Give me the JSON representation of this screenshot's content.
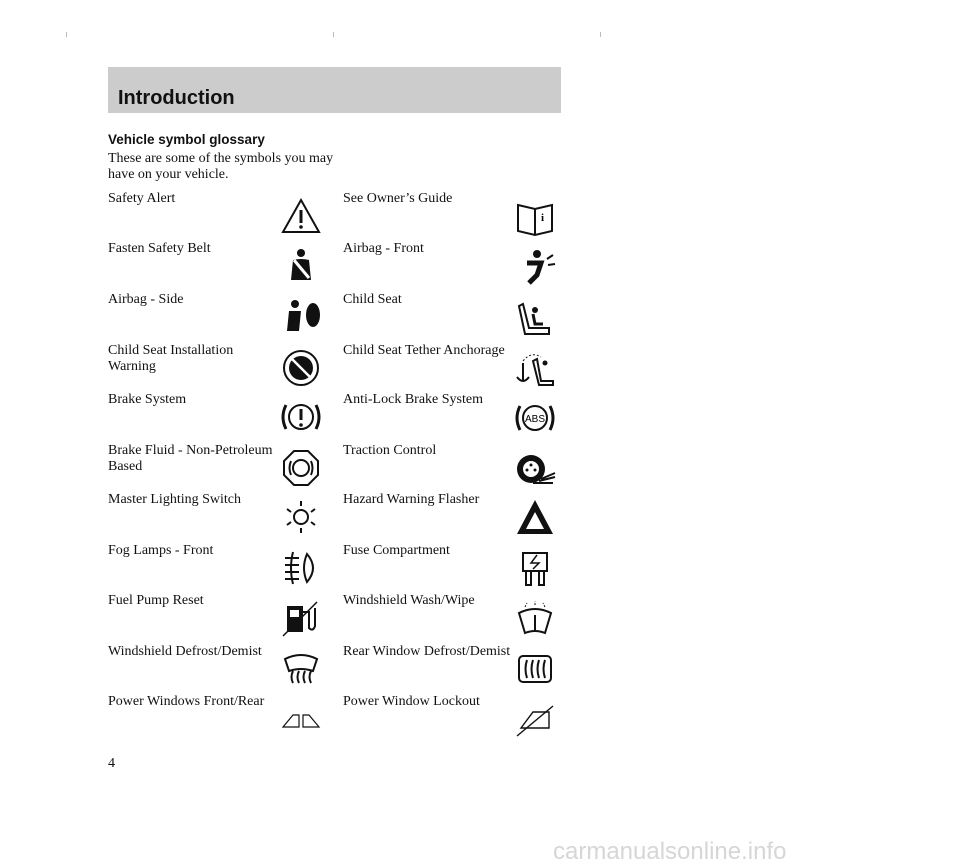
{
  "header": {
    "title": "Introduction"
  },
  "section": {
    "title": "Vehicle symbol glossary",
    "intro": "These are some of the symbols you may have on your vehicle."
  },
  "symbols": [
    {
      "label": "Safety Alert",
      "icon": "warning-triangle-icon"
    },
    {
      "label": "See Owner’s Guide",
      "icon": "owners-guide-book-icon"
    },
    {
      "label": "Fasten Safety Belt",
      "icon": "seatbelt-icon"
    },
    {
      "label": "Airbag - Front",
      "icon": "airbag-front-icon"
    },
    {
      "label": "Airbag - Side",
      "icon": "airbag-side-icon"
    },
    {
      "label": "Child Seat",
      "icon": "child-seat-icon"
    },
    {
      "label": "Child Seat Installation Warning",
      "icon": "child-seat-warning-icon"
    },
    {
      "label": "Child Seat Tether Anchorage",
      "icon": "child-seat-tether-icon"
    },
    {
      "label": "Brake System",
      "icon": "brake-system-icon"
    },
    {
      "label": "Anti-Lock Brake System",
      "icon": "abs-icon"
    },
    {
      "label": "Brake Fluid - Non-Petroleum Based",
      "icon": "brake-fluid-icon"
    },
    {
      "label": "Traction Control",
      "icon": "traction-control-icon"
    },
    {
      "label": "Master Lighting Switch",
      "icon": "lighting-switch-icon"
    },
    {
      "label": "Hazard Warning Flasher",
      "icon": "hazard-triangle-icon"
    },
    {
      "label": "Fog Lamps - Front",
      "icon": "fog-lamp-icon"
    },
    {
      "label": "Fuse Compartment",
      "icon": "fuse-icon"
    },
    {
      "label": "Fuel Pump Reset",
      "icon": "fuel-pump-reset-icon"
    },
    {
      "label": "Windshield Wash/Wipe",
      "icon": "windshield-wiper-icon"
    },
    {
      "label": "Windshield Defrost/Demist",
      "icon": "windshield-defrost-icon"
    },
    {
      "label": "Rear Window Defrost/Demist",
      "icon": "rear-defrost-icon"
    },
    {
      "label": "Power Windows Front/Rear",
      "icon": "power-windows-icon"
    },
    {
      "label": "Power Window Lockout",
      "icon": "power-window-lockout-icon"
    }
  ],
  "footer": {
    "page_number": "4"
  },
  "watermark": "carmanualsonline.info"
}
